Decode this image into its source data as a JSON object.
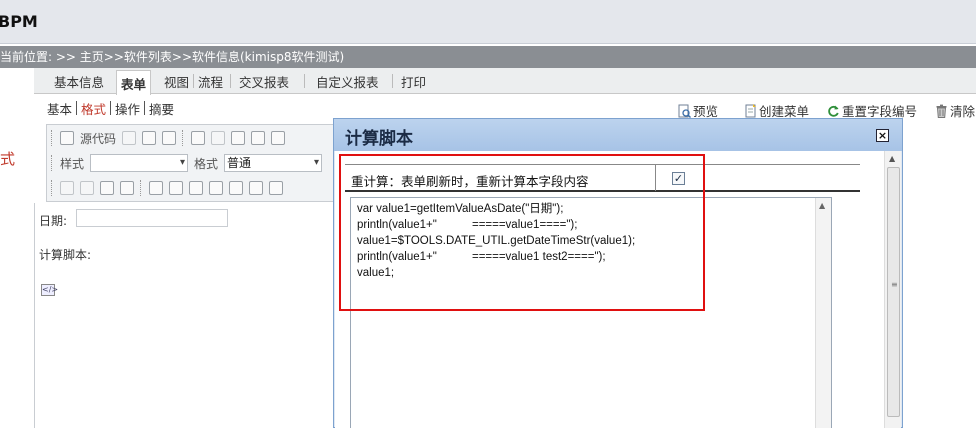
{
  "app": {
    "title": "BPM"
  },
  "breadcrumb": "当前位置: >> 主页>>软件列表>>软件信息(kimisp8软件测试)",
  "left_char": "式",
  "tabs": [
    {
      "label": "基本信息"
    },
    {
      "label": "表单"
    },
    {
      "label": "视图"
    },
    {
      "label": "流程"
    },
    {
      "label": "交叉报表"
    },
    {
      "label": "自定义报表"
    },
    {
      "label": "打印"
    }
  ],
  "subtabs": [
    {
      "label": "基本"
    },
    {
      "label": "格式"
    },
    {
      "label": "操作"
    },
    {
      "label": "摘要"
    }
  ],
  "actions": {
    "preview": "预览",
    "create_menu": "创建菜单",
    "reset_field_no": "重置字段编号",
    "clear": "清除"
  },
  "editor_toolbar": {
    "source_label": "源代码",
    "style_label": "样式",
    "format_label": "格式",
    "format_value": "普通",
    "style_value": ""
  },
  "form": {
    "date_label": "日期:",
    "script_label": "计算脚本:"
  },
  "dialog": {
    "title": "计算脚本",
    "close_glyph": "×",
    "recalc_label": "重计算：表单刷新时，重新计算本字段内容",
    "recalc_checked": true,
    "check_glyph": "✓",
    "script": "var value1=getItemValueAsDate(\"日期\");\nprintln(value1+\"           =====value1====\");\nvalue1=$TOOLS.DATE_UTIL.getDateTimeStr(value1);\nprintln(value1+\"           =====value1 test2====\");\nvalue1;"
  },
  "colors": {
    "highlight": "#e01010",
    "active_subtab": "#c0392b",
    "dialog_titlebar": "#a7c3e6",
    "breadcrumb_bg": "#8a8e93"
  },
  "icons": {
    "preview": "document-preview-icon",
    "create_menu": "new-document-icon",
    "reset": "refresh-icon",
    "clear": "trash-icon"
  }
}
